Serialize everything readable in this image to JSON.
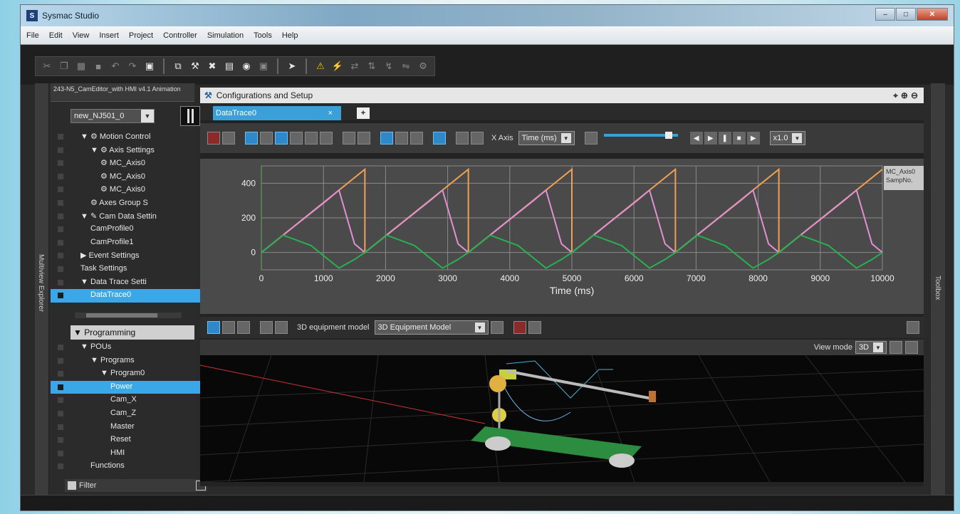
{
  "window": {
    "title": "Sysmac Studio",
    "icon": "S"
  },
  "menu": [
    "File",
    "Edit",
    "View",
    "Insert",
    "Project",
    "Controller",
    "Simulation",
    "Tools",
    "Help"
  ],
  "explorer": {
    "vertical_label": "Multiview Explorer",
    "project_name": "243-N5_CamEditor_with HMI v4.1 Animation",
    "controller": "new_NJ501_0",
    "config_tree": [
      {
        "label": "▼ ⚙ Motion Control",
        "indent": 1
      },
      {
        "label": "▼ ⚙ Axis Settings",
        "indent": 2
      },
      {
        "label": "⚙ MC_Axis0",
        "indent": 3
      },
      {
        "label": "⚙ MC_Axis0",
        "indent": 3
      },
      {
        "label": "⚙ MC_Axis0",
        "indent": 3
      },
      {
        "label": "⚙ Axes Group S",
        "indent": 2
      },
      {
        "label": "▼ ✎ Cam Data Settin",
        "indent": 1
      },
      {
        "label": "CamProfile0",
        "indent": 2
      },
      {
        "label": "CamProfile1",
        "indent": 2
      },
      {
        "label": "▶ Event Settings",
        "indent": 1
      },
      {
        "label": "Task Settings",
        "indent": 1
      },
      {
        "label": "▼ Data Trace Setti",
        "indent": 1
      },
      {
        "label": "DataTrace0",
        "indent": 2,
        "selected": true
      }
    ],
    "programming_header": "▼ Programming",
    "prog_tree": [
      {
        "label": "▼ POUs",
        "indent": 1
      },
      {
        "label": "▼ Programs",
        "indent": 2
      },
      {
        "label": "▼ Program0",
        "indent": 3
      },
      {
        "label": "Power",
        "indent": 4,
        "selected": true
      },
      {
        "label": "Cam_X",
        "indent": 4
      },
      {
        "label": "Cam_Z",
        "indent": 4
      },
      {
        "label": "Master",
        "indent": 4
      },
      {
        "label": "Reset",
        "indent": 4
      },
      {
        "label": "HMI",
        "indent": 4
      },
      {
        "label": "Functions",
        "indent": 2
      }
    ],
    "filter_label": "Filter"
  },
  "config": {
    "title": "Configurations and Setup",
    "tab_label": "DataTrace0",
    "tab_close": "×",
    "add_tab": "+",
    "x_axis_label": "X Axis",
    "x_axis_value": "Time (ms)",
    "speed": "x1.0"
  },
  "legend": {
    "line1": "MC_Axis0",
    "line2": "SampNo."
  },
  "model": {
    "label": "3D equipment model",
    "value": "3D Equipment Model",
    "view_mode_label": "View mode",
    "view_mode_value": "3D"
  },
  "toolbox_label": "Toolbox",
  "chart_data": {
    "type": "line",
    "xlabel": "Time (ms)",
    "ylabel": "",
    "xlim": [
      0,
      10000
    ],
    "ylim": [
      -100,
      500
    ],
    "x_ticks": [
      0,
      1000,
      2000,
      3000,
      4000,
      5000,
      6000,
      7000,
      8000,
      9000,
      10000
    ],
    "y_ticks": [
      0,
      200,
      400
    ],
    "period_ms": 1667,
    "series": [
      {
        "color": "#f0a050",
        "x": [
          0,
          1667,
          1667,
          3333,
          3333,
          5000,
          5000,
          6667,
          6667,
          8333,
          8333,
          10000
        ],
        "values": [
          0,
          480,
          0,
          480,
          0,
          480,
          0,
          480,
          0,
          480,
          0,
          480
        ]
      },
      {
        "color": "#e090d0",
        "x": [
          0,
          1050,
          1250,
          1500,
          1667,
          2717,
          2917,
          3167,
          3333,
          4383,
          4583,
          4833,
          5000,
          6050,
          6250,
          6500,
          6667,
          7717,
          7917,
          8167,
          8333,
          9383,
          9583,
          9833,
          10000
        ],
        "values": [
          0,
          300,
          360,
          50,
          0,
          300,
          360,
          50,
          0,
          300,
          360,
          50,
          0,
          300,
          360,
          50,
          0,
          300,
          360,
          50,
          0,
          300,
          360,
          50,
          0
        ]
      },
      {
        "color": "#28b050",
        "x": [
          0,
          350,
          800,
          1250,
          1500,
          1667,
          2017,
          2467,
          2917,
          3167,
          3333,
          3683,
          4133,
          4583,
          4833,
          5000,
          5350,
          5800,
          6250,
          6500,
          6667,
          7017,
          7467,
          7917,
          8167,
          8333,
          8683,
          9133,
          9583,
          9833,
          10000
        ],
        "values": [
          0,
          100,
          40,
          -90,
          -40,
          0,
          100,
          40,
          -90,
          -40,
          0,
          100,
          40,
          -90,
          -40,
          0,
          100,
          40,
          -90,
          -40,
          0,
          100,
          40,
          -90,
          -40,
          0,
          100,
          40,
          -90,
          -40,
          0
        ]
      }
    ]
  }
}
